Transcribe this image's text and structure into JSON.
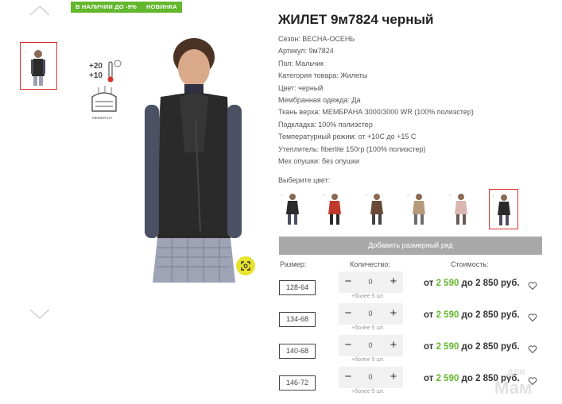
{
  "badges": {
    "stock": "В НАЛИЧИИ ДО -9%",
    "new": "НОВИНКА"
  },
  "product": {
    "title": "ЖИЛЕТ 9м7824 черный",
    "properties": [
      "Сезон: ВЕСНА-ОСЕНЬ",
      "Артикул: 9м7824",
      "Пол: Мальчик",
      "Категория товара: Жилеты",
      "Цвет: черный",
      "Мембранная одежда: Да",
      "Ткань верха: МЕМБРАНА 3000/3000 WR (100% полиэстер)",
      "Подкладка: 100% полиэстер",
      "Температурный режим: от +10С до +15 С",
      "Утеплитель: fiberlite 150гр (100% полиэстер)",
      "Мех опушки: без опушки"
    ],
    "icon_temp_text": "+20\n+10",
    "icon_membrane_text": "МЕМБРАНА"
  },
  "colors": {
    "label": "Выберите цвет:",
    "swatches": [
      "black-vest-1",
      "red-jacket",
      "brown-suit",
      "beige-suit",
      "pink-jacket",
      "black-vest-selected"
    ],
    "selected_index": 5
  },
  "add_size_button": "Добавить размерный ряд",
  "table": {
    "col_size": "Размер:",
    "col_qty": "Количество:",
    "col_price": "Стоимость:",
    "rows": [
      {
        "size": "128-64",
        "qty": "0",
        "more": "+более 5 шт.",
        "from": "от ",
        "price": "2 590",
        "to": " до 2 850 руб."
      },
      {
        "size": "134-68",
        "qty": "0",
        "more": "+более 5 шт.",
        "from": "от ",
        "price": "2 590",
        "to": " до 2 850 руб."
      },
      {
        "size": "140-68",
        "qty": "0",
        "more": "+более 5 шт.",
        "from": "от ",
        "price": "2 590",
        "to": " до 2 850 руб."
      },
      {
        "size": "146-72",
        "qty": "0",
        "more": "+более 5 шт.",
        "from": "от ",
        "price": "2 590",
        "to": " до 2 850 руб."
      }
    ]
  },
  "watermark": "для\nМам",
  "colors_theme": {
    "accent_green": "#62b72d",
    "selected_red": "#d9322b",
    "zoom_yellow": "#e8e22d"
  }
}
